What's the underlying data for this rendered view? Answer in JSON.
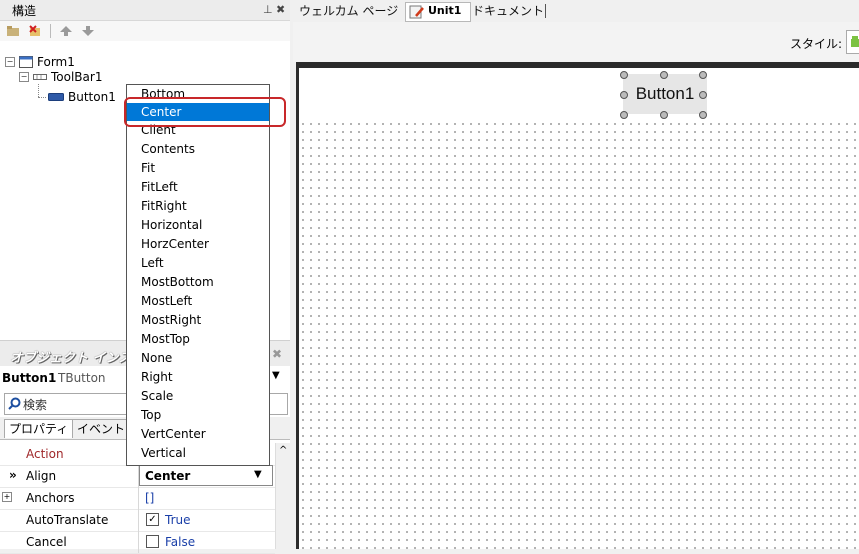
{
  "structure": {
    "title": "構造",
    "tree": [
      "Form1",
      "ToolBar1",
      "Button1"
    ]
  },
  "designer_tabs": {
    "welcome": "ウェルカム ページ",
    "unit1": "Unit1",
    "document": "ドキュメント"
  },
  "style_label": "スタイル:",
  "design": {
    "button_caption": "Button1"
  },
  "object_inspector": {
    "title": "オブジェクト インスペクタ",
    "selected_name": "Button1",
    "selected_type": "TButton",
    "search_placeholder": "検索",
    "tabs": [
      "プロパティ",
      "イベント"
    ],
    "properties": [
      {
        "name": "Action",
        "value": ""
      },
      {
        "name": "Align",
        "value": "Center"
      },
      {
        "name": "Anchors",
        "value": "[]"
      },
      {
        "name": "AutoTranslate",
        "value": "True"
      },
      {
        "name": "Cancel",
        "value": "False"
      }
    ]
  },
  "align_dropdown": {
    "selected": "Center",
    "options": [
      "Bottom",
      "Center",
      "Client",
      "Contents",
      "Fit",
      "FitLeft",
      "FitRight",
      "Horizontal",
      "HorzCenter",
      "Left",
      "MostBottom",
      "MostLeft",
      "MostRight",
      "MostTop",
      "None",
      "Right",
      "Scale",
      "Top",
      "VertCenter",
      "Vertical"
    ]
  },
  "colors": {
    "selection": "#0078d7",
    "highlight_box": "#c8282a",
    "property_name_highlight": "#a0282a",
    "value_blue": "#1a3fa8"
  }
}
